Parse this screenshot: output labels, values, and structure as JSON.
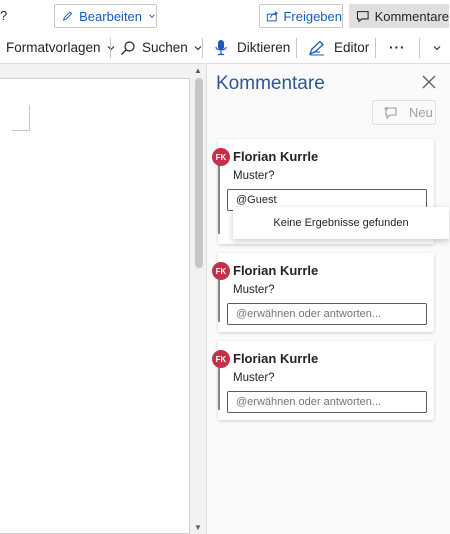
{
  "toolbar": {
    "left_glyph": "?",
    "edit_label": "Bearbeiten",
    "share_label": "Freigeben",
    "comments_label": "Kommentare"
  },
  "ribbon": {
    "styles_label": "Formatvorlagen",
    "search_label": "Suchen",
    "dictate_label": "Diktieren",
    "editor_label": "Editor",
    "more_label": "···"
  },
  "comments_pane": {
    "title": "Kommentare",
    "new_label": "Neu",
    "cards": [
      {
        "initials": "FK",
        "author": "Florian Kurrle",
        "text": "Muster?",
        "reply_value": "@Guest",
        "reply_placeholder": ""
      },
      {
        "initials": "FK",
        "author": "Florian Kurrle",
        "text": "Muster?",
        "reply_value": "",
        "reply_placeholder": "@erwähnen oder antworten..."
      },
      {
        "initials": "FK",
        "author": "Florian Kurrle",
        "text": "Muster?",
        "reply_value": "",
        "reply_placeholder": "@erwähnen oder antworten..."
      }
    ],
    "mention_dropdown": "Keine Ergebnisse gefunden"
  },
  "colors": {
    "accent": "#185abd",
    "pane_title": "#2b579a",
    "avatar": "#c4314b"
  }
}
